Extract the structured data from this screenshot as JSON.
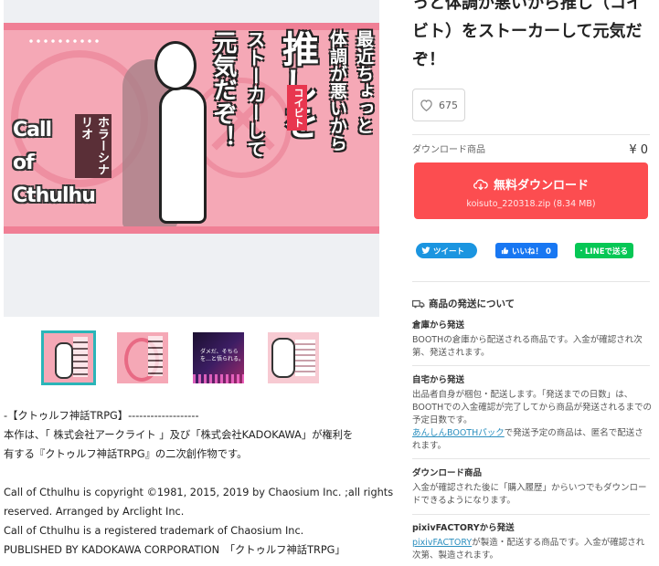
{
  "product": {
    "title": "っと体調が悪いから推し（コイビト）をストーカーして元気だぞ！",
    "like_count": "675",
    "category_label": "ダウンロード商品",
    "price": "¥ 0",
    "download_label": "無料ダウンロード",
    "file_info": "koisuto_220318.zip (8.34 MB)"
  },
  "cover": {
    "brand_lines": [
      "Call",
      "of",
      "Cthulhu"
    ],
    "horror_tag": "ホラーシナリオ",
    "title_cols": [
      "最近ちょっと",
      "体調が悪いから",
      "推しを",
      "ストーカーして",
      "元気だぞ！"
    ],
    "koibito": "コイビト"
  },
  "thumbnails": [
    {
      "label": ""
    },
    {
      "label": ""
    },
    {
      "label": "ダメだ、そちらを…と悟られる。"
    },
    {
      "label": ""
    }
  ],
  "share": {
    "tweet": "ツイート",
    "facebook": "いいね！ 0",
    "line": "LINEで送る"
  },
  "shipping": {
    "heading": "商品の発送について",
    "blocks": [
      {
        "title": "倉庫から発送",
        "body": "BOOTHの倉庫から配送される商品です。入金が確認され次第、発送されます。",
        "link": "",
        "after_link": ""
      },
      {
        "title": "自宅から発送",
        "body": "出品者自身が梱包・配送します。「発送までの日数」は、BOOTHでの入金確認が完了してから商品が発送されるまでの予定日数です。",
        "link": "あんしんBOOTHパック",
        "after_link": "で発送予定の商品は、匿名で配送されます。"
      },
      {
        "title": "ダウンロード商品",
        "body": "入金が確認された後に「購入履歴」からいつでもダウンロードできるようになります。",
        "link": "",
        "after_link": ""
      },
      {
        "title": "pixivFACTORYから発送",
        "body": "",
        "link": "pixivFACTORY",
        "after_link": "が製造・配送する商品です。入金が確認され次第、製造されます。"
      }
    ]
  },
  "description": {
    "lines": [
      "-【クトゥルフ神話TRPG】-------------------",
      "本作は、「 株式会社アークライト 」及び「株式会社KADOKAWA」が権利を",
      "有する『クトゥルフ神話TRPG』の二次創作物です。",
      "",
      "Call of Cthulhu is copyright ©1981, 2015, 2019 by Chaosium Inc. ;all rights",
      "reserved. Arranged by Arclight Inc.",
      "Call of Cthulhu is a registered trademark of Chaosium Inc.",
      "PUBLISHED BY KADOKAWA CORPORATION　「クトゥルフ神話TRPG」",
      "--------------------------------------------------"
    ]
  },
  "colors": {
    "download_bg": "#fc4d50",
    "cover_pink": "#f5a8b6",
    "thumb_selected": "#2bb5b8",
    "tweet": "#1b95e0",
    "facebook": "#1877f2",
    "line": "#06c755"
  }
}
